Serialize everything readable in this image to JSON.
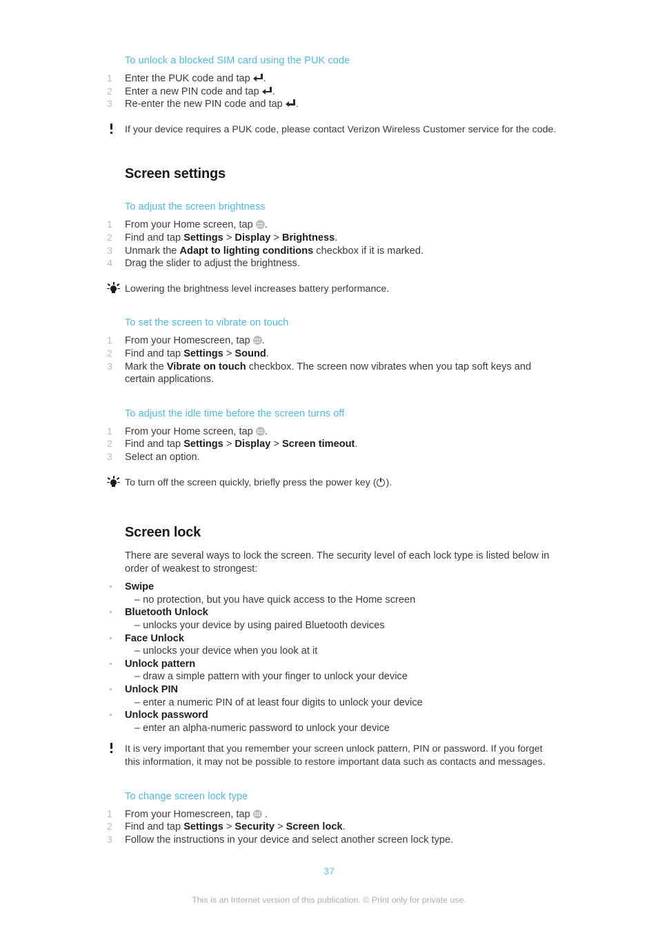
{
  "document": {
    "page_number": "37",
    "disclaimer": "This is an Internet version of this publication. © Print only for private use.",
    "accent_blue": "#4cb9e7",
    "page_number_color": "#61c4ea",
    "body_color": "#3b3b3b"
  },
  "puk": {
    "heading": "To unlock a blocked SIM card using the PUK code",
    "steps": [
      {
        "num": "1",
        "pre": "Enter the PUK code and tap ",
        "icon": "enter-key-icon",
        "post": "."
      },
      {
        "num": "2",
        "pre": "Enter a new PIN code and tap ",
        "icon": "enter-key-icon",
        "post": "."
      },
      {
        "num": "3",
        "pre": "Re-enter the new PIN code and tap ",
        "icon": "enter-key-icon",
        "post": "."
      }
    ],
    "note": {
      "icon": "warning-exclamation-icon",
      "text": "If your device requires a PUK code, please contact Verizon Wireless Customer service for the code."
    }
  },
  "screen_settings": {
    "heading": "Screen settings",
    "brightness": {
      "heading": "To adjust the screen brightness",
      "steps": [
        {
          "num": "1",
          "pre": "From your Home screen, tap ",
          "icon": "app-drawer-icon",
          "post": "."
        },
        {
          "num": "2",
          "pre": "Find and tap ",
          "b1": "Settings",
          "sep1": " > ",
          "b2": "Display",
          "sep2": " > ",
          "b3": "Brightness",
          "post": "."
        },
        {
          "num": "3",
          "pre": "Unmark the ",
          "b1": "Adapt to lighting conditions",
          "post": " checkbox if it is marked."
        },
        {
          "num": "4",
          "pre": "Drag the slider to adjust the brightness."
        }
      ],
      "tip": {
        "icon": "light-bulb-tip-icon",
        "text": "Lowering the brightness level increases battery performance."
      }
    },
    "vibrate": {
      "heading": "To set the screen to vibrate on touch",
      "steps": [
        {
          "num": "1",
          "pre": "From your Homescreen, tap ",
          "icon": "app-drawer-icon",
          "post": "."
        },
        {
          "num": "2",
          "pre": "Find and tap ",
          "b1": "Settings",
          "sep1": " > ",
          "b2": "Sound",
          "post": "."
        },
        {
          "num": "3",
          "pre": "Mark the ",
          "b1": "Vibrate on touch",
          "post": " checkbox. The screen now vibrates when you tap soft keys and certain applications."
        }
      ]
    },
    "idle_time": {
      "heading": "To adjust the idle time before the screen turns off",
      "steps": [
        {
          "num": "1",
          "pre": "From your Home screen, tap ",
          "icon": "app-drawer-icon",
          "post": "."
        },
        {
          "num": "2",
          "pre": "Find and tap ",
          "b1": "Settings",
          "sep1": " > ",
          "b2": "Display",
          "sep2": " > ",
          "b3": "Screen timeout",
          "post": "."
        },
        {
          "num": "3",
          "pre": "Select an option."
        }
      ],
      "tip": {
        "icon": "light-bulb-tip-icon",
        "pre": "To turn off the screen quickly, briefly press the power key (",
        "icon_inline": "power-key-icon",
        "post": ")."
      }
    }
  },
  "screen_lock": {
    "heading": "Screen lock",
    "intro": "There are several ways to lock the screen. The security level of each lock type is listed below in order of weakest to strongest:",
    "lock_types": [
      {
        "term": "Swipe",
        "desc": "– no protection, but you have quick access to the Home screen"
      },
      {
        "term": "Bluetooth Unlock",
        "desc": "– unlocks your device by using paired Bluetooth devices"
      },
      {
        "term": "Face Unlock",
        "desc": "– unlocks your device when you look at it"
      },
      {
        "term": "Unlock pattern",
        "desc": "– draw a simple pattern with your finger to unlock your device"
      },
      {
        "term": "Unlock PIN",
        "desc": "– enter a numeric PIN of at least four digits to unlock your device"
      },
      {
        "term": "Unlock password",
        "desc": "– enter an alpha-numeric password to unlock your device"
      }
    ],
    "note": {
      "icon": "warning-exclamation-icon",
      "text": "It is very important that you remember your screen unlock pattern, PIN or password. If you forget this information, it may not be possible to restore important data such as contacts and messages."
    },
    "change_type": {
      "heading": "To change screen lock type",
      "steps": [
        {
          "num": "1",
          "pre": "From your Homescreen, tap ",
          "icon": "app-drawer-icon",
          "post": " ."
        },
        {
          "num": "2",
          "pre": "Find and tap ",
          "b1": "Settings",
          "sep1": " > ",
          "b2": "Security",
          "sep2": " > ",
          "b3": "Screen lock",
          "post": "."
        },
        {
          "num": "3",
          "pre": "Follow the instructions in your device and select another screen lock type."
        }
      ]
    }
  }
}
